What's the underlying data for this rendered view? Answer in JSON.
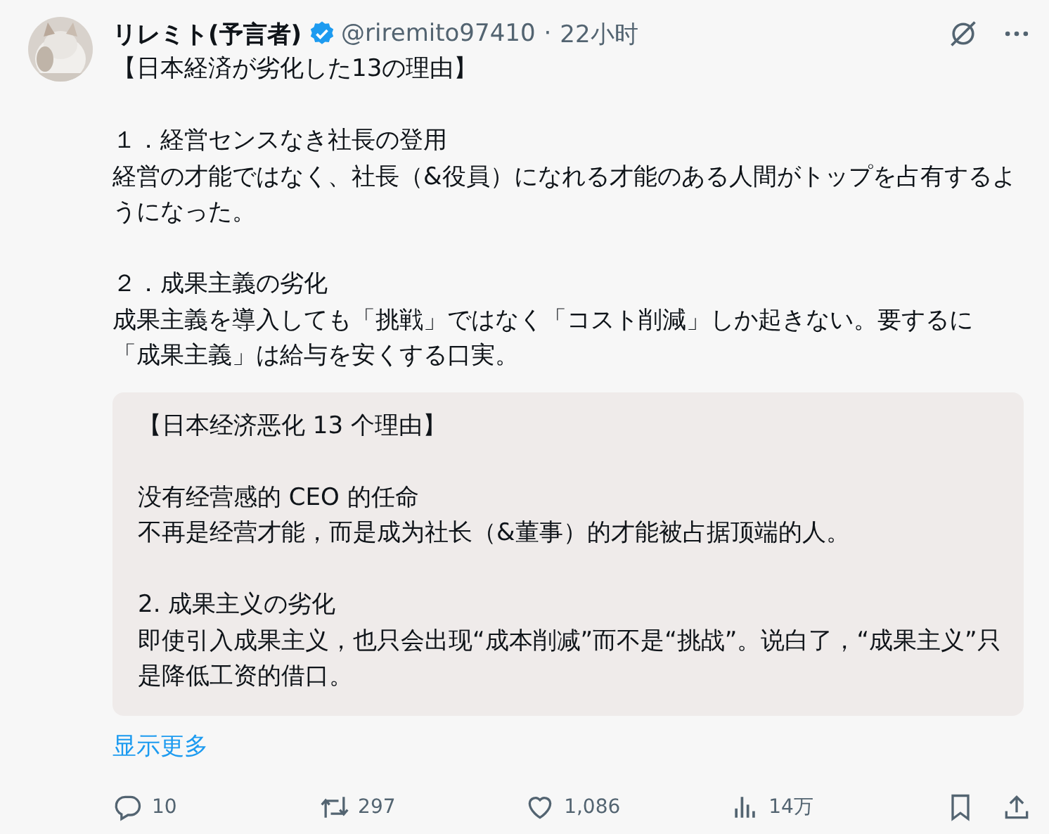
{
  "post": {
    "author": {
      "name": "リレミト(予言者)",
      "verified": true,
      "handle": "@riremito97410",
      "separator": "·",
      "time": "22小时"
    },
    "body": [
      [
        "【日本経済が劣化した13の理由】"
      ],
      [
        "１．経営センスなき社長の登用",
        "経営の才能ではなく、社長（&役員）になれる才能のある人間がトップを占有するようになった。"
      ],
      [
        "２．成果主義の劣化",
        "成果主義を導入しても「挑戦」ではなく「コスト削減」しか起きない。要するに「成果主義」は給与を安くする口実。"
      ]
    ],
    "translation": [
      [
        "【日本经济恶化 13 个理由】"
      ],
      [
        "没有经营感的 CEO 的任命",
        "不再是经营才能，而是成为社长（&董事）的才能被占据顶端的人。"
      ],
      [
        "2. 成果主义の劣化",
        "即使引入成果主义，也只会出现“成本削减”而不是“挑战”。说白了，“成果主义”只是降低工资的借口。"
      ]
    ],
    "show_more": "显示更多",
    "actions": [
      {
        "kind": "reply",
        "count": "10"
      },
      {
        "kind": "repost",
        "count": "297"
      },
      {
        "kind": "like",
        "count": "1,086"
      },
      {
        "kind": "views",
        "count": "14万"
      },
      {
        "kind": "bookmark"
      },
      {
        "kind": "share"
      }
    ]
  }
}
